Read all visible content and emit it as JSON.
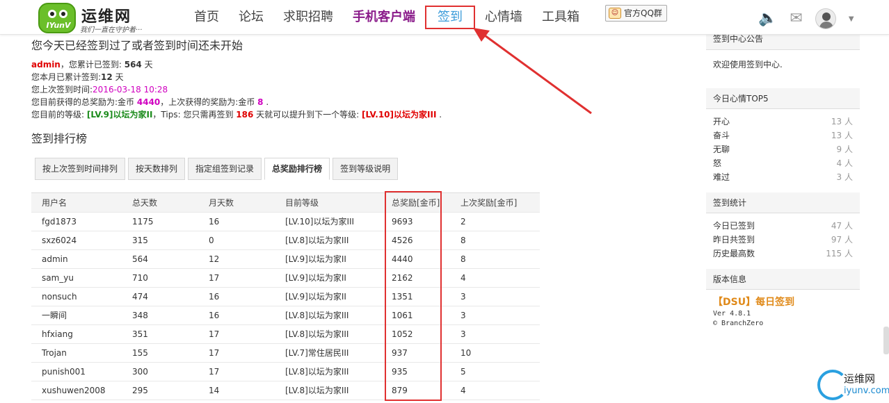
{
  "header": {
    "logo_badge": "IYunV",
    "logo_title": "运维网",
    "logo_slogan": "我们一直在守护着···",
    "nav": [
      {
        "label": "首页"
      },
      {
        "label": "论坛"
      },
      {
        "label": "求职招聘"
      },
      {
        "label": "手机客户端"
      },
      {
        "label": "签到"
      },
      {
        "label": "心情墙"
      },
      {
        "label": "工具箱"
      }
    ],
    "qq_group": "官方QQ群",
    "sound_icon": "speaker-icon",
    "mail_icon": "mail-icon"
  },
  "status": {
    "title": "您今天已经签到过了或者签到时间还未开始",
    "username": "admin",
    "total_days_text": "，您累计已签到:",
    "total_days": "564",
    "total_days_unit": "天",
    "month_text": "您本月已累计签到:",
    "month_days": "12",
    "month_unit": "天",
    "last_text": "您上次签到时间:",
    "last_time": "2016-03-18 10:28",
    "reward_text": "您目前获得的总奖励为:金币",
    "reward_total": "4440",
    "last_reward_text": "，上次获得的奖励为:金币",
    "last_reward": "8",
    "level_text": "您目前的等级:",
    "level": "[LV.9]以坛为家II",
    "tips_text": "，Tips: 您只需再签到",
    "tips_days": "186",
    "tips_rest": "天就可以提升到下一个等级:",
    "next_level": "[LV.10]以坛为家III",
    "period": ".",
    "period2": "."
  },
  "ranking": {
    "title": "签到排行榜",
    "tabs": [
      "按上次签到时间排列",
      "按天数排列",
      "指定组签到记录",
      "总奖励排行榜",
      "签到等级说明"
    ],
    "columns": [
      "用户名",
      "总天数",
      "月天数",
      "目前等级",
      "总奖励[金币]",
      "上次奖励[金币]"
    ],
    "rows": [
      [
        "fgd1873",
        "1175",
        "16",
        "[LV.10]以坛为家III",
        "9693",
        "2"
      ],
      [
        "sxz6024",
        "315",
        "0",
        "[LV.8]以坛为家III",
        "4526",
        "8"
      ],
      [
        "admin",
        "564",
        "12",
        "[LV.9]以坛为家II",
        "4440",
        "8"
      ],
      [
        "sam_yu",
        "710",
        "17",
        "[LV.9]以坛为家II",
        "2162",
        "4"
      ],
      [
        "nonsuch",
        "474",
        "16",
        "[LV.9]以坛为家II",
        "1351",
        "3"
      ],
      [
        "一瞬间",
        "348",
        "16",
        "[LV.8]以坛为家III",
        "1061",
        "3"
      ],
      [
        "hfxiang",
        "351",
        "17",
        "[LV.8]以坛为家III",
        "1052",
        "3"
      ],
      [
        "Trojan",
        "155",
        "17",
        "[LV.7]常住居民III",
        "937",
        "10"
      ],
      [
        "punish001",
        "300",
        "17",
        "[LV.8]以坛为家III",
        "935",
        "5"
      ],
      [
        "xushuwen2008",
        "295",
        "14",
        "[LV.8]以坛为家III",
        "879",
        "4"
      ]
    ]
  },
  "sidebar": {
    "notice_title": "签到中心公告",
    "notice_body": "欢迎使用签到中心.",
    "mood_title": "今日心情TOP5",
    "moods": [
      {
        "name": "开心",
        "count": "13 人"
      },
      {
        "name": "奋斗",
        "count": "13 人"
      },
      {
        "name": "无聊",
        "count": "9 人"
      },
      {
        "name": "怒",
        "count": "4 人"
      },
      {
        "name": "难过",
        "count": "3 人"
      }
    ],
    "stats_title": "签到统计",
    "stats": [
      {
        "name": "今日已签到",
        "count": "47 人"
      },
      {
        "name": "昨日共签到",
        "count": "97 人"
      },
      {
        "name": "历史最高数",
        "count": "115 人"
      }
    ],
    "version_title": "版本信息",
    "plugin_name": "【DSU】每日签到",
    "version": "Ver 4.8.1",
    "copyright": "© BranchZero"
  },
  "watermark": {
    "name": "运维网",
    "url": "iyunv.com"
  },
  "colors": {
    "highlight_red": "#e03030",
    "nav_active": "#3a9bd9",
    "nav_mobile": "#8a1b8a"
  }
}
